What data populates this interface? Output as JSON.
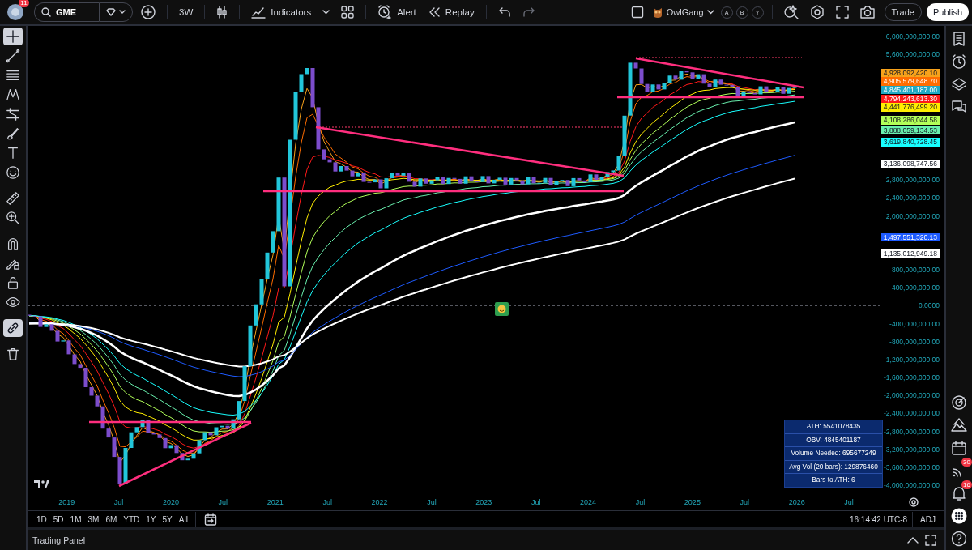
{
  "top_bar": {
    "avatar_badge": "11",
    "symbol": "GME",
    "interval": "3W",
    "indicators": "Indicators",
    "alert": "Alert",
    "replay": "Replay",
    "account": "OwlGang",
    "layouts": [
      "A",
      "B",
      "Y"
    ],
    "trade": "Trade",
    "publish": "Publish"
  },
  "left_tools": [
    {
      "kind": "crosshair",
      "selected": true
    },
    {
      "kind": "trendline",
      "selected": false
    },
    {
      "kind": "fib",
      "selected": false
    },
    {
      "kind": "pattern",
      "selected": false
    },
    {
      "kind": "forecast",
      "selected": false
    },
    {
      "kind": "brush",
      "selected": false
    },
    {
      "kind": "text",
      "selected": false
    },
    {
      "kind": "emoji",
      "selected": false
    },
    {
      "kind": "ruler",
      "selected": false
    },
    {
      "kind": "zoom",
      "selected": false
    },
    {
      "kind": "magnet",
      "selected": false
    },
    {
      "kind": "pencil-lock",
      "selected": false
    },
    {
      "kind": "lock",
      "selected": false
    },
    {
      "kind": "eye",
      "selected": false
    },
    {
      "kind": "link",
      "selected": true
    },
    {
      "kind": "trash",
      "selected": false
    }
  ],
  "right_sidebar": {
    "top": [
      {
        "kind": "watchlist"
      },
      {
        "kind": "alarm"
      },
      {
        "kind": "layers"
      },
      {
        "kind": "chat"
      }
    ],
    "bottom": [
      {
        "kind": "target"
      },
      {
        "kind": "peaks"
      },
      {
        "kind": "calendar"
      },
      {
        "kind": "feed",
        "badge": "30"
      },
      {
        "kind": "bell",
        "badge": "16"
      },
      {
        "kind": "apps"
      },
      {
        "kind": "help"
      }
    ]
  },
  "chart": {
    "price_ticks": [
      "6,000,000,000.00",
      "5,600,000,000.00",
      "2,800,000,000.00",
      "2,400,000,000.00",
      "2,000,000,000.00",
      "800,000,000.00",
      "400,000,000.00",
      "0.0000",
      "-400,000,000.00",
      "-800,000,000.00",
      "-1,200,000,000.00",
      "-1,600,000,000.00",
      "-2,000,000,000.00",
      "-2,400,000,000.00",
      "-2,800,000,000.00",
      "-3,200,000,000.00",
      "-3,600,000,000.00",
      "-4,000,000,000.00"
    ],
    "price_badges": [
      {
        "text": "4,928,092,420.10",
        "color": "#f7a21b"
      },
      {
        "text": "4,905,579,648.70",
        "color": "#ff6d00"
      },
      {
        "text": "4,845,401,187.00",
        "color": "#1fa9c4"
      },
      {
        "text": "4,794,243,613.30",
        "color": "#ff1a1a"
      },
      {
        "text": "4,441,776,499.20",
        "color": "#ffee00"
      },
      {
        "text": "4,108,286,044.58",
        "color": "#b2ff59"
      },
      {
        "text": "3,888,059,134.53",
        "color": "#69f0ae"
      },
      {
        "text": "3,619,840,728.45",
        "color": "#18ffff"
      },
      {
        "text": "3,136,098,747.56",
        "color": "#ffffff"
      },
      {
        "text": "1,497,551,320.13",
        "color": "#1e5bff"
      },
      {
        "text": "1,135,012,949.18",
        "color": "#ffffff"
      }
    ],
    "time_labels": [
      "2019",
      "Jul",
      "2020",
      "Jul",
      "2021",
      "Jul",
      "2022",
      "Jul",
      "2023",
      "Jul",
      "2024",
      "Jul",
      "2025",
      "Jul",
      "2026",
      "Jul"
    ],
    "stats_table": [
      "ATH: 5541078435",
      "OBV: 4845401187",
      "Volume Needed: 695677249",
      "Avg Vol (20 bars): 129876460",
      "Bars to ATH: 6"
    ]
  },
  "range_bar": {
    "ranges": [
      "1D",
      "5D",
      "1M",
      "3M",
      "6M",
      "YTD",
      "1Y",
      "5Y",
      "All"
    ],
    "clock": "16:14:42 UTC-8",
    "adjust": "ADJ"
  },
  "trading_panel": {
    "title": "Trading Panel"
  }
}
